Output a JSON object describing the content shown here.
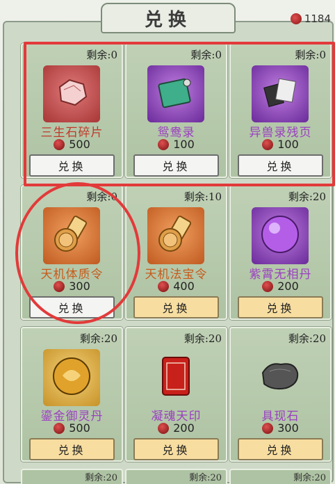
{
  "header": {
    "title": "兑换",
    "currency_amount": "1184",
    "currency_icon": "rose-gem-icon"
  },
  "items": [
    {
      "remain": "剩余:0",
      "name": "三生石碎片",
      "price": "500",
      "button": "兑换",
      "name_color": "red",
      "bg": "red",
      "icon": "stone-fragment-icon",
      "button_style": "white"
    },
    {
      "remain": "剩余:0",
      "name": "鸳鸯录",
      "price": "100",
      "button": "兑换",
      "name_color": "purple",
      "bg": "purple",
      "icon": "book-icon",
      "button_style": "white"
    },
    {
      "remain": "剩余:0",
      "name": "异兽录残页",
      "price": "100",
      "button": "兑换",
      "name_color": "purple",
      "bg": "purple",
      "icon": "scroll-pages-icon",
      "button_style": "white"
    },
    {
      "remain": "剩余:0",
      "name": "天机体质令",
      "price": "300",
      "button": "兑换",
      "name_color": "orange",
      "bg": "orange",
      "icon": "token-icon",
      "button_style": "white"
    },
    {
      "remain": "剩余:10",
      "name": "天机法宝令",
      "price": "400",
      "button": "兑换",
      "name_color": "orange",
      "bg": "orange",
      "icon": "token-icon",
      "button_style": "gold"
    },
    {
      "remain": "剩余:20",
      "name": "紫霄无相丹",
      "price": "200",
      "button": "兑换",
      "name_color": "purple",
      "bg": "purple",
      "icon": "purple-orb-icon",
      "button_style": "gold"
    },
    {
      "remain": "剩余:20",
      "name": "鎏金御灵丹",
      "price": "500",
      "button": "兑换",
      "name_color": "purple",
      "bg": "yellow",
      "icon": "gold-orb-icon",
      "button_style": "gold"
    },
    {
      "remain": "剩余:20",
      "name": "凝魂天印",
      "price": "200",
      "button": "兑换",
      "name_color": "purple",
      "bg": "none",
      "icon": "red-seal-icon",
      "button_style": "gold"
    },
    {
      "remain": "剩余:20",
      "name": "具现石",
      "price": "300",
      "button": "兑换",
      "name_color": "purple",
      "bg": "none",
      "icon": "grey-stone-icon",
      "button_style": "gold"
    }
  ],
  "partial_row": [
    "剩余:20",
    "剩余:20",
    "剩余:20"
  ],
  "colors": {
    "highlight": "#e23a3a",
    "card_bg": "#aec3a3",
    "gold_button": "#f7dda0"
  }
}
